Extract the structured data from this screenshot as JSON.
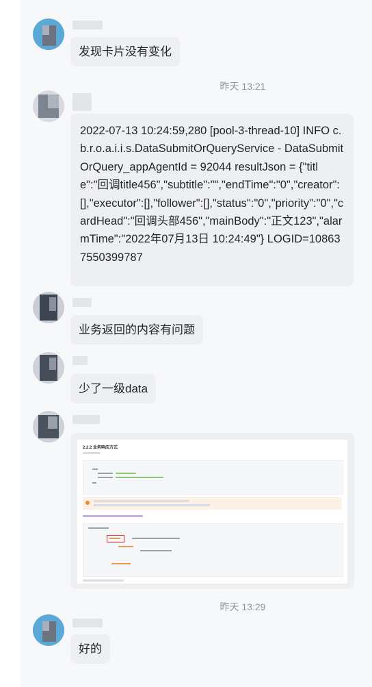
{
  "messages": [
    {
      "type": "text",
      "text": "发现卡片没有变化"
    },
    {
      "type": "timestamp",
      "text": "昨天 13:21"
    },
    {
      "type": "text",
      "text": "2022-07-13 10:24:59,280 [pool-3-thread-10] INFO c.b.r.o.a.i.i.s.DataSubmitOrQueryService - DataSubmitOrQuery_appAgentId = 92044 resultJson = {\"title\":\"回调title456\",\"subtitle\":\"\",\"endTime\":\"0\",\"creator\":[],\"executor\":[],\"follower\":[],\"status\":\"0\",\"priority\":\"0\",\"cardHead\":\"回调头部456\",\"mainBody\":\"正文123\",\"alarmTime\":\"2022年07月13日 10:24:49\"} LOGID=108637550399787"
    },
    {
      "type": "text",
      "text": "业务返回的内容有问题"
    },
    {
      "type": "text",
      "text": "少了一级data"
    },
    {
      "type": "image",
      "text": "2.2.2 业务响应方式"
    },
    {
      "type": "timestamp",
      "text": "昨天 13:29"
    },
    {
      "type": "text",
      "text": "好的"
    }
  ],
  "colors": {
    "bubble": "#eeeff1",
    "background": "#f7f8fa",
    "timestamp": "#8f959e",
    "highlight_box": "#e02020",
    "warning_bg": "#fdf1e6"
  }
}
